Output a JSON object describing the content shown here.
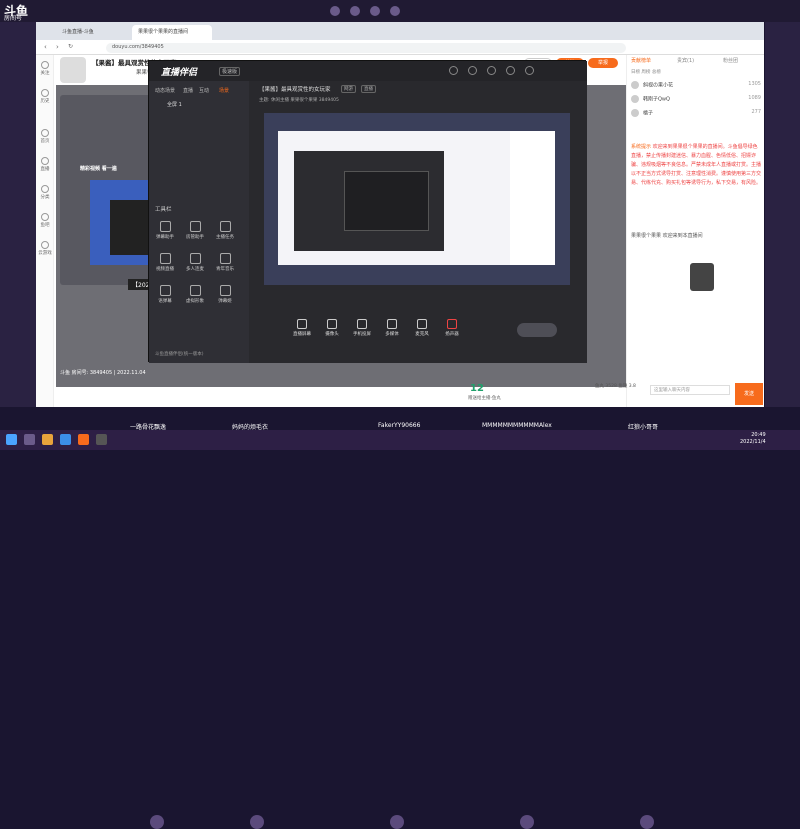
{
  "outer": {
    "logo": "斗鱼",
    "room_label": "房间号",
    "room_number": "3849405"
  },
  "browser": {
    "tabs": [
      "斗鱼直播-斗鱼",
      "果果很个果果的直播间"
    ],
    "url": "douyu.com/3849405",
    "sidebar": [
      "关注",
      "历史",
      "首页",
      "直播",
      "分类",
      "鱼吧",
      "云游戏"
    ]
  },
  "room": {
    "title": "【果酱】最具观赏性的女玩家",
    "anchor": "果果很个果果",
    "follow": "关注",
    "fans_count": "1785",
    "report": "举报"
  },
  "player": {
    "ghost_text": "精彩视频 看一遍",
    "ghost_date": "【2022-11-02】"
  },
  "app": {
    "logo": "直播伴侣",
    "version": "极速版",
    "left_tabs": [
      "动态场景",
      "直播",
      "互动",
      "场景"
    ],
    "scene": "全屏 1",
    "tools_title": "工具栏",
    "tools": [
      "弹幕助手",
      "房管助手",
      "主播任务",
      "视频直播",
      "多人连麦",
      "青年音乐",
      "语弹幕",
      "虚拟形象",
      "弹幕姬"
    ],
    "title": "【果酱】最具观赏性的女玩家",
    "tag1": "网游",
    "tag2": "直播",
    "subtitle": "主题: 休闲主播    果果很个果果    3849405",
    "bottom_buttons": [
      "直播屏幕",
      "摄像头",
      "手机投屏",
      "多媒体",
      "麦克风",
      "扬声器"
    ],
    "footer": "斗鱼直播伴侣(统一版本)"
  },
  "chat": {
    "tabs": [
      "贡献榜单",
      "贵宾(1)",
      "粉丝团"
    ],
    "rank_tabs": "日榜   周榜   总榜",
    "rank": [
      {
        "name": "斜视の果小花",
        "value": "1305"
      },
      {
        "name": "韩刚子QwQ",
        "value": "1089"
      },
      {
        "name": "橘子",
        "value": "277"
      }
    ],
    "notice_label": "系统提示",
    "notice": "欢迎来到果果很个果果的直播间。斗鱼倡导绿色直播，禁止传播封建迷信、暴力血腥、色情低俗、招嫖诈骗、违规吸烟等不良信息。严禁未成年人直播或打赏。主播以不正当方式诱导打赏、注意理性消费。谨慎使用第三方交易、代练代充、购买礼包等诱导行为，私下交易，有风险。",
    "welcome": "果果很个果果  欢迎来到本直播间",
    "input_placeholder": "这里输入聊天内容",
    "send": "发送",
    "balance": "鱼丸 3528  鱼翅 3.8"
  },
  "infobar": {
    "text": "斗鱼 房间号: 3849405 | 2022.11.04",
    "gift_count": "12",
    "gift_sub": "赠送给主播·鱼丸"
  },
  "lineup": [
    "一路骨花飘逸",
    "妈妈的烦毛衣",
    "FakerYY90666",
    "MMMMMMMMMMMAlex",
    "红狼小哥哥"
  ],
  "taskbar": {
    "time": "20:49",
    "date": "2022/11/4"
  },
  "colors": {
    "brand": "#f76b1c",
    "taskbar": "#2d1f45"
  }
}
